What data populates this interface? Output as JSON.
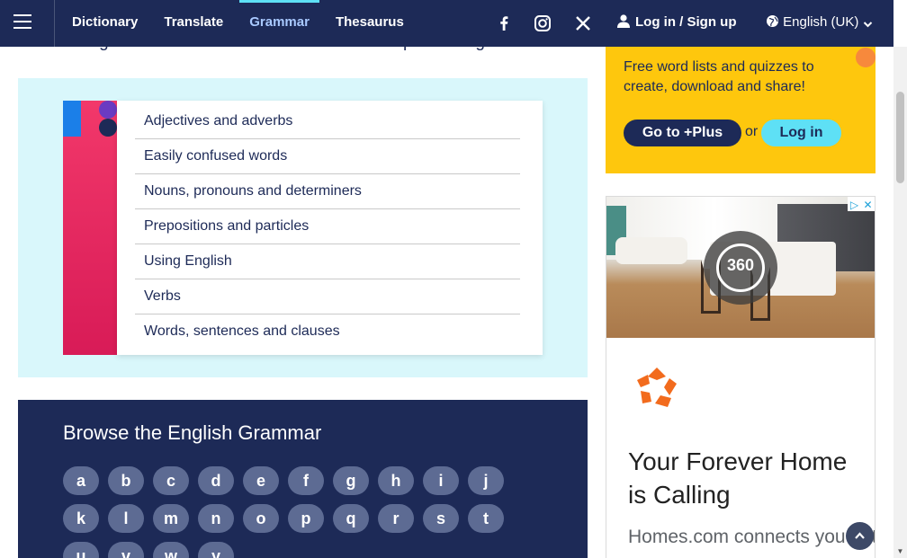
{
  "header": {
    "nav": [
      {
        "label": "Dictionary",
        "active": false
      },
      {
        "label": "Translate",
        "active": false
      },
      {
        "label": "Grammar",
        "active": true
      },
      {
        "label": "Thesaurus",
        "active": false
      }
    ],
    "social_icons": [
      "facebook-icon",
      "instagram-icon",
      "x-icon"
    ],
    "login_label": "Log in / Sign up",
    "language_label": "English (UK)"
  },
  "intro": {
    "text": "how grammar is used in natural written and spoken English."
  },
  "categories": {
    "items": [
      "Adjectives and adverbs",
      "Easily confused words",
      "Nouns, pronouns and determiners",
      "Prepositions and particles",
      "Using English",
      "Verbs",
      "Words, sentences and clauses"
    ]
  },
  "browse": {
    "title": "Browse the English Grammar",
    "letters": [
      "a",
      "b",
      "c",
      "d",
      "e",
      "f",
      "g",
      "h",
      "i",
      "j",
      "k",
      "l",
      "m",
      "n",
      "o",
      "p",
      "q",
      "r",
      "s",
      "t",
      "u",
      "v",
      "w",
      "y"
    ]
  },
  "plus": {
    "text": "Free word lists and quizzes to create, download and share!",
    "goto_label": "Go to +Plus",
    "or_label": "or",
    "login_label": "Log in"
  },
  "ad": {
    "vr_label": "360",
    "headline": "Your Forever Home is Calling",
    "body": "Homes.com connects you to the listing agent, the"
  },
  "colors": {
    "header_bg": "#1d2a57",
    "accent_cyan": "#5ee0f5",
    "plus_yellow": "#fec70d",
    "panel_bg": "#d9f7fb"
  }
}
